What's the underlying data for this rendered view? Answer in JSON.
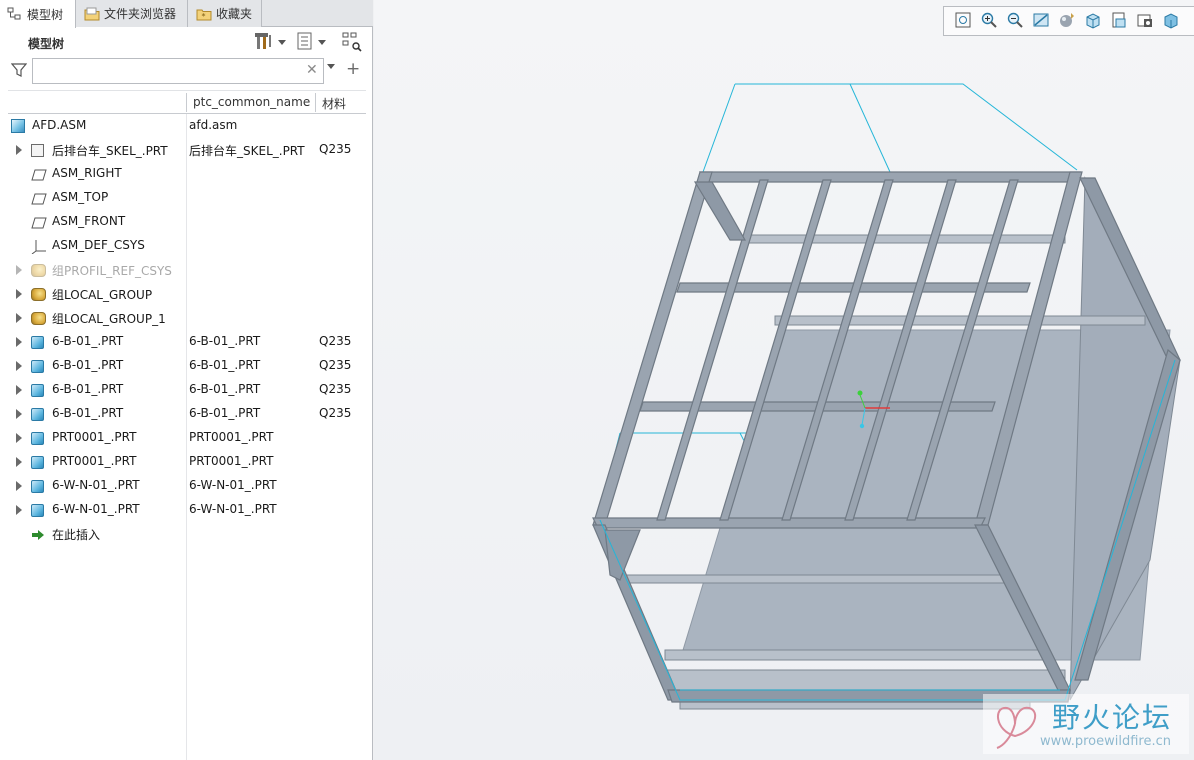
{
  "tabs": [
    {
      "label": "模型树",
      "icon": "model-tree-icon",
      "active": true
    },
    {
      "label": "文件夹浏览器",
      "icon": "folder-browser-icon",
      "active": false
    },
    {
      "label": "收藏夹",
      "icon": "favorites-icon",
      "active": false
    }
  ],
  "tree_panel": {
    "title": "模型树",
    "search": {
      "value": "",
      "placeholder": ""
    },
    "columns": [
      "ptc_common_name",
      "材料"
    ]
  },
  "tree_rows": [
    {
      "name": "AFD.ASM",
      "common_name": "afd.asm",
      "material": "",
      "icon": "assembly-icon"
    },
    {
      "name": "后排台车_SKEL_.PRT",
      "common_name": "后排台车_SKEL_.PRT",
      "material": "Q235",
      "icon": "skeleton-icon"
    },
    {
      "name": "ASM_RIGHT",
      "common_name": "",
      "material": "",
      "icon": "datum-plane-icon"
    },
    {
      "name": "ASM_TOP",
      "common_name": "",
      "material": "",
      "icon": "datum-plane-icon"
    },
    {
      "name": "ASM_FRONT",
      "common_name": "",
      "material": "",
      "icon": "datum-plane-icon"
    },
    {
      "name": "ASM_DEF_CSYS",
      "common_name": "",
      "material": "",
      "icon": "csys-icon"
    },
    {
      "name": "组PROFIL_REF_CSYS",
      "common_name": "",
      "material": "",
      "icon": "group-icon"
    },
    {
      "name": "组LOCAL_GROUP",
      "common_name": "",
      "material": "",
      "icon": "group-icon"
    },
    {
      "name": "组LOCAL_GROUP_1",
      "common_name": "",
      "material": "",
      "icon": "group-icon"
    },
    {
      "name": "6-B-01_.PRT",
      "common_name": "6-B-01_.PRT",
      "material": "Q235",
      "icon": "part-icon"
    },
    {
      "name": "6-B-01_.PRT",
      "common_name": "6-B-01_.PRT",
      "material": "Q235",
      "icon": "part-icon"
    },
    {
      "name": "6-B-01_.PRT",
      "common_name": "6-B-01_.PRT",
      "material": "Q235",
      "icon": "part-icon"
    },
    {
      "name": "6-B-01_.PRT",
      "common_name": "6-B-01_.PRT",
      "material": "Q235",
      "icon": "part-icon"
    },
    {
      "name": "PRT0001_.PRT",
      "common_name": "PRT0001_.PRT",
      "material": "",
      "icon": "part-icon"
    },
    {
      "name": "PRT0001_.PRT",
      "common_name": "PRT0001_.PRT",
      "material": "",
      "icon": "part-icon"
    },
    {
      "name": "6-W-N-01_.PRT",
      "common_name": "6-W-N-01_.PRT",
      "material": "",
      "icon": "part-icon"
    },
    {
      "name": "6-W-N-01_.PRT",
      "common_name": "6-W-N-01_.PRT",
      "material": "",
      "icon": "part-icon"
    },
    {
      "name": "在此插入",
      "common_name": "",
      "material": "",
      "icon": "insert-here-icon"
    }
  ],
  "view_toolbar": [
    "refit-icon",
    "zoom-in-icon",
    "zoom-out-icon",
    "repaint-icon",
    "appearance-icon",
    "saved-orientations-icon",
    "view-manager-icon",
    "perspective-icon",
    "display-style-icon"
  ],
  "watermark": {
    "title": "野火论坛",
    "url": "www.proewildfire.cn"
  },
  "colors": {
    "frame_steel": "#8e99a6",
    "panel_sheet": "#aab4c0",
    "highlight": "#25b6d8",
    "accent": "#2b7aa5"
  }
}
